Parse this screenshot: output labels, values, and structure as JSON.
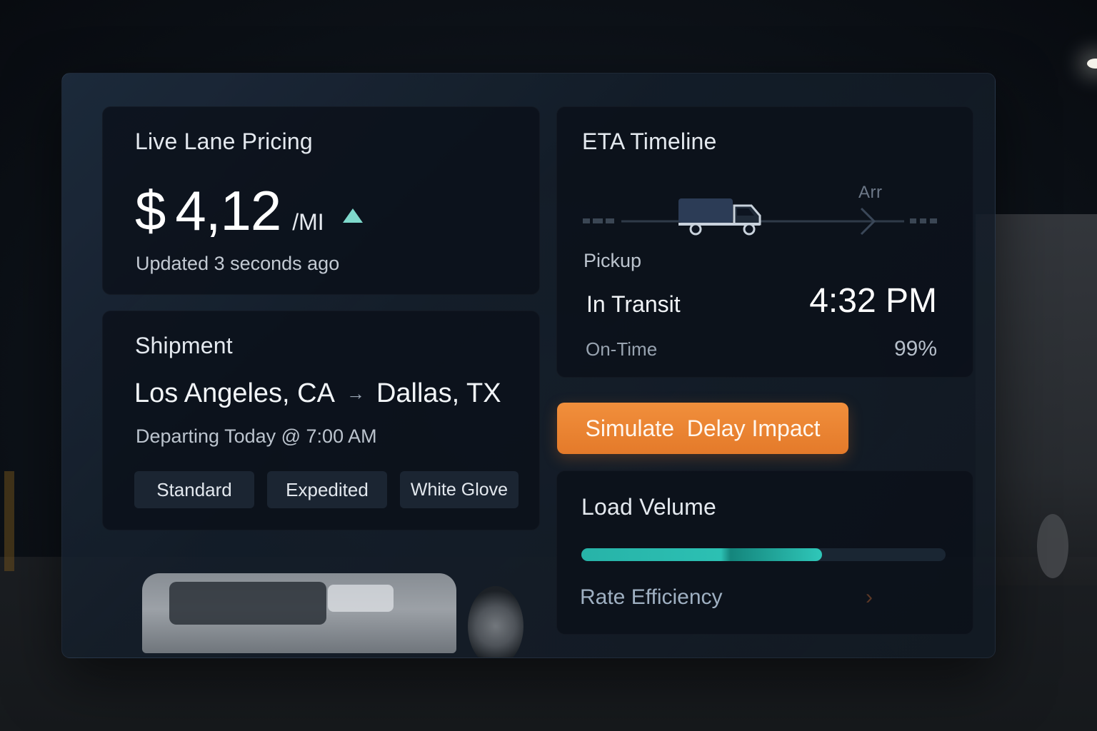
{
  "pricing": {
    "title": "Live Lane Pricing",
    "currency": "$",
    "value": "4,12",
    "unit": "/MI",
    "trend": "up",
    "updated": "Updated 3 seconds ago"
  },
  "shipment": {
    "title": "Shipment",
    "origin": "Los Angeles, CA",
    "destination": "Dallas, TX",
    "departing": "Departing Today @ 7:00 AM",
    "service_levels": [
      "Standard",
      "Expedited",
      "White Glove"
    ]
  },
  "eta": {
    "title": "ETA Timeline",
    "arrival_label": "Arr",
    "pickup_label": "Pickup",
    "status": "In Transit",
    "time": "4:32 PM",
    "on_time_label": "On-Time",
    "on_time_value": "99%"
  },
  "cta": {
    "label": "Simulate  Delay Impact"
  },
  "load": {
    "title": "Load Velume",
    "progress": 0.66,
    "rate_label": "Rate Efficiency"
  },
  "colors": {
    "accent_orange": "#e47a2a",
    "accent_teal": "#2cc0b3",
    "trend_up": "#7fd9cc"
  },
  "icons": {
    "trend": "triangle-up-icon",
    "route": "arrow-right-icon",
    "truck": "truck-icon",
    "chevron": "chevron-right-icon"
  }
}
